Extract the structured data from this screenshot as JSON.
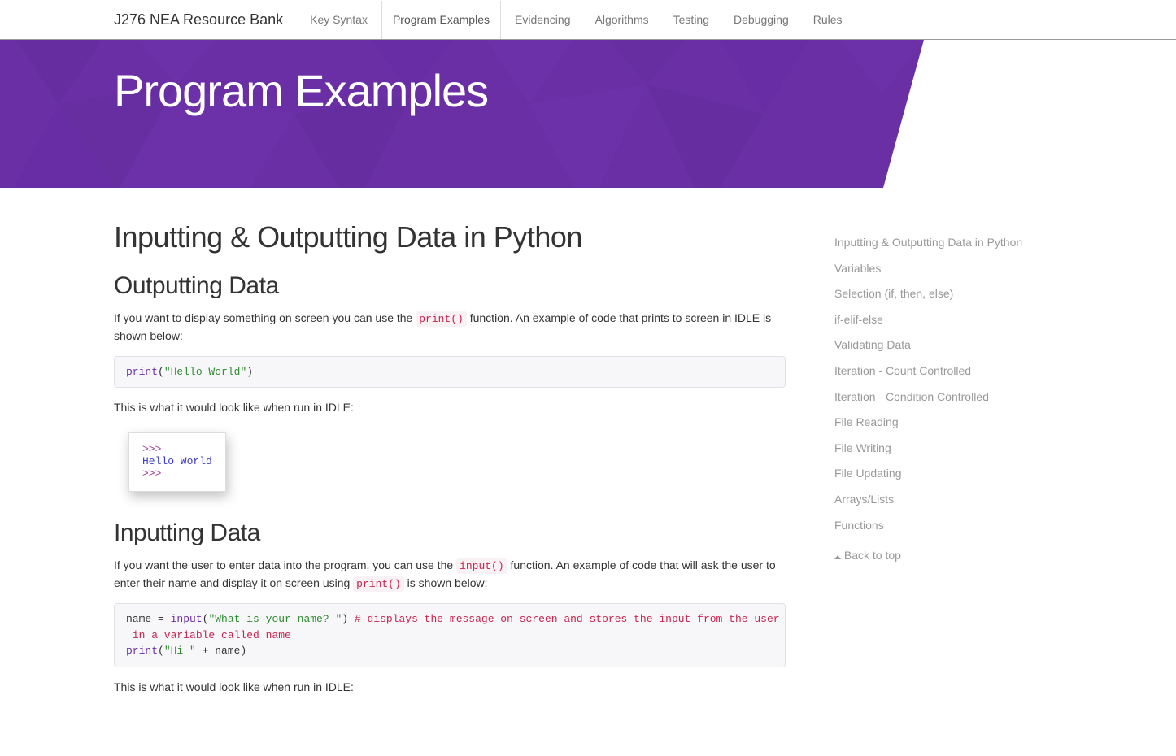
{
  "nav": {
    "brand": "J276 NEA Resource Bank",
    "items": [
      {
        "label": "Key Syntax"
      },
      {
        "label": "Program Examples"
      },
      {
        "label": "Evidencing"
      },
      {
        "label": "Algorithms"
      },
      {
        "label": "Testing"
      },
      {
        "label": "Debugging"
      },
      {
        "label": "Rules"
      }
    ],
    "active_index": 1
  },
  "hero": {
    "title": "Program Examples"
  },
  "main": {
    "h1": "Inputting & Outputting Data in Python",
    "out_h2": "Outputting Data",
    "out_p1a": "If you want to display something on screen you can use the ",
    "out_p1_code": "print()",
    "out_p1b": " function. An example of code that prints to screen in IDLE is shown below:",
    "out_code_fn": "print",
    "out_code_paren_open": "(",
    "out_code_str": "\"Hello World\"",
    "out_code_paren_close": ")",
    "out_p2": "This is what it would look like when run in IDLE:",
    "idle1_prompt1": ">>>",
    "idle1_line": "Hello World",
    "idle1_prompt2": ">>>",
    "in_h2": "Inputting Data",
    "in_p1a": "If you want the user to enter data into the program, you can use the ",
    "in_p1_code1": "input()",
    "in_p1b": " function. An example of code that will ask the user to enter their name and display it on screen using ",
    "in_p1_code2": "print()",
    "in_p1c": " is shown below:",
    "in_code_line1_pre": "name = ",
    "in_code_line1_fn": "input",
    "in_code_line1_paren": "(",
    "in_code_line1_str": "\"What is your name? \"",
    "in_code_line1_paren2": ") ",
    "in_code_line1_cmt": "# displays the message on screen and stores the input from the user",
    "in_code_line2_cmt": " in a variable called name",
    "in_code_line3_fn": "print",
    "in_code_line3_paren": "(",
    "in_code_line3_str": "\"Hi \"",
    "in_code_line3_rest": " + name)",
    "in_p2": "This is what it would look like when run in IDLE:"
  },
  "sidebar": {
    "items": [
      "Inputting & Outputting Data in Python",
      "Variables",
      "Selection (if, then, else)",
      "if-elif-else",
      "Validating Data",
      "Iteration - Count Controlled",
      "Iteration - Condition Controlled",
      "File Reading",
      "File Writing",
      "File Updating",
      "Arrays/Lists",
      "Functions"
    ],
    "backtop": "Back to top"
  }
}
